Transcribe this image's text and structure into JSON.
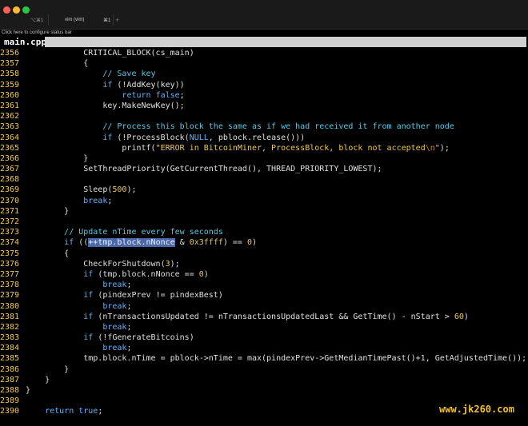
{
  "window": {
    "shortcut_hint": "⌥⌘1",
    "tab_title": "vim (vim)",
    "tab_shortcut": "⌘1",
    "new_tab_symbol": "+"
  },
  "status_hint": "Click here to configure status bar",
  "buffer": {
    "name": "main.cpp"
  },
  "watermark": "www.jk260.com",
  "colors": {
    "background": "#000000",
    "line_number": "#f2c94c",
    "keyword": "#5fb4ff",
    "comment": "#58c9e8",
    "selection": "#4b68a8"
  },
  "code_lines": [
    {
      "n": "2356",
      "t": [
        {
          "s": "            CRITICAL_BLOCK(cs_main)"
        }
      ]
    },
    {
      "n": "2357",
      "t": [
        {
          "s": "            {"
        }
      ]
    },
    {
      "n": "2358",
      "t": [
        {
          "s": "                "
        },
        {
          "s": "// Save key",
          "c": "cm"
        }
      ]
    },
    {
      "n": "2359",
      "t": [
        {
          "s": "                "
        },
        {
          "s": "if",
          "c": "kw"
        },
        {
          "s": " (!AddKey(key))"
        }
      ]
    },
    {
      "n": "2360",
      "t": [
        {
          "s": "                    "
        },
        {
          "s": "return false",
          "c": "kw"
        },
        {
          "s": ";"
        }
      ]
    },
    {
      "n": "2361",
      "t": [
        {
          "s": "                key.MakeNewKey();"
        }
      ]
    },
    {
      "n": "2362",
      "t": [
        {
          "s": ""
        }
      ]
    },
    {
      "n": "2363",
      "t": [
        {
          "s": "                "
        },
        {
          "s": "// Process this block the same as if we had received it from another node",
          "c": "cm"
        }
      ]
    },
    {
      "n": "2364",
      "t": [
        {
          "s": "                "
        },
        {
          "s": "if",
          "c": "kw"
        },
        {
          "s": " (!ProcessBlock("
        },
        {
          "s": "NULL",
          "c": "kw"
        },
        {
          "s": ", pblock.release()))"
        }
      ]
    },
    {
      "n": "2365",
      "t": [
        {
          "s": "                    printf("
        },
        {
          "s": "\"ERROR in BitcoinMiner, ProcessBlock, block not accepted",
          "c": "st"
        },
        {
          "s": "\\n",
          "c": "ct"
        },
        {
          "s": "\"",
          "c": "st"
        },
        {
          "s": ");"
        }
      ]
    },
    {
      "n": "2366",
      "t": [
        {
          "s": "            }"
        }
      ]
    },
    {
      "n": "2367",
      "t": [
        {
          "s": "            SetThreadPriority(GetCurrentThread(), THREAD_PRIORITY_LOWEST);"
        }
      ]
    },
    {
      "n": "2368",
      "t": [
        {
          "s": ""
        }
      ]
    },
    {
      "n": "2369",
      "t": [
        {
          "s": "            Sleep("
        },
        {
          "s": "500",
          "c": "nu"
        },
        {
          "s": ");"
        }
      ]
    },
    {
      "n": "2370",
      "t": [
        {
          "s": "            "
        },
        {
          "s": "break",
          "c": "kw"
        },
        {
          "s": ";"
        }
      ]
    },
    {
      "n": "2371",
      "t": [
        {
          "s": "        }"
        }
      ]
    },
    {
      "n": "2372",
      "t": [
        {
          "s": ""
        }
      ]
    },
    {
      "n": "2373",
      "t": [
        {
          "s": "        "
        },
        {
          "s": "// Update nTime every few seconds",
          "c": "cm"
        }
      ]
    },
    {
      "n": "2374",
      "t": [
        {
          "s": "        "
        },
        {
          "s": "if",
          "c": "kw"
        },
        {
          "s": " (("
        },
        {
          "s": "++tmp.block.nNonce",
          "c": "sel"
        },
        {
          "s": " & "
        },
        {
          "s": "0x3ffff",
          "c": "nu"
        },
        {
          "s": ") == "
        },
        {
          "s": "0",
          "c": "nu"
        },
        {
          "s": ")"
        }
      ]
    },
    {
      "n": "2375",
      "t": [
        {
          "s": "        {"
        }
      ]
    },
    {
      "n": "2376",
      "t": [
        {
          "s": "            CheckForShutdown("
        },
        {
          "s": "3",
          "c": "nu"
        },
        {
          "s": ");"
        }
      ]
    },
    {
      "n": "2377",
      "t": [
        {
          "s": "            "
        },
        {
          "s": "if",
          "c": "kw"
        },
        {
          "s": " (tmp.block.nNonce == "
        },
        {
          "s": "0",
          "c": "nu"
        },
        {
          "s": ")"
        }
      ]
    },
    {
      "n": "2378",
      "t": [
        {
          "s": "                "
        },
        {
          "s": "break",
          "c": "kw"
        },
        {
          "s": ";"
        }
      ]
    },
    {
      "n": "2379",
      "t": [
        {
          "s": "            "
        },
        {
          "s": "if",
          "c": "kw"
        },
        {
          "s": " (pindexPrev != pindexBest)"
        }
      ]
    },
    {
      "n": "2380",
      "t": [
        {
          "s": "                "
        },
        {
          "s": "break",
          "c": "kw"
        },
        {
          "s": ";"
        }
      ]
    },
    {
      "n": "2381",
      "t": [
        {
          "s": "            "
        },
        {
          "s": "if",
          "c": "kw"
        },
        {
          "s": " (nTransactionsUpdated != nTransactionsUpdatedLast && GetTime() - nStart > "
        },
        {
          "s": "60",
          "c": "nu"
        },
        {
          "s": ")"
        }
      ]
    },
    {
      "n": "2382",
      "t": [
        {
          "s": "                "
        },
        {
          "s": "break",
          "c": "kw"
        },
        {
          "s": ";"
        }
      ]
    },
    {
      "n": "2383",
      "t": [
        {
          "s": "            "
        },
        {
          "s": "if",
          "c": "kw"
        },
        {
          "s": " (!fGenerateBitcoins)"
        }
      ]
    },
    {
      "n": "2384",
      "t": [
        {
          "s": "                "
        },
        {
          "s": "break",
          "c": "kw"
        },
        {
          "s": ";"
        }
      ]
    },
    {
      "n": "2385",
      "t": [
        {
          "s": "            tmp.block.nTime = pblock->nTime = max(pindexPrev->GetMedianTimePast()+1, GetAdjustedTime());"
        }
      ]
    },
    {
      "n": "2386",
      "t": [
        {
          "s": "        }"
        }
      ]
    },
    {
      "n": "2387",
      "t": [
        {
          "s": "    }"
        }
      ]
    },
    {
      "n": "2388",
      "t": [
        {
          "s": "}"
        }
      ]
    },
    {
      "n": "2389",
      "t": [
        {
          "s": ""
        }
      ]
    },
    {
      "n": "2390",
      "t": [
        {
          "s": "    "
        },
        {
          "s": "return true",
          "c": "kw"
        },
        {
          "s": ";"
        }
      ]
    }
  ]
}
